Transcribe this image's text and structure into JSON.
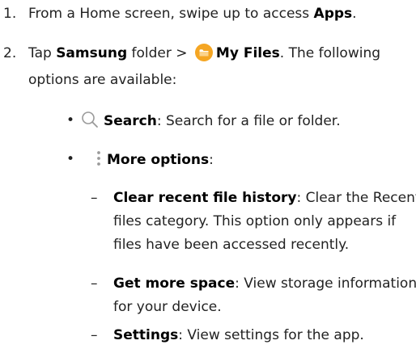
{
  "steps": [
    {
      "number": "1.",
      "text_a": "From a Home screen, swipe up to access ",
      "bold_a": "Apps",
      "text_b": "."
    },
    {
      "number": "2.",
      "text_a": "Tap ",
      "bold_a": "Samsung",
      "text_b": " folder > ",
      "bold_b": "My Files",
      "text_c": ". The following",
      "line2": "options are available:",
      "icon": "folder-icon"
    }
  ],
  "options": [
    {
      "icon": "search-icon",
      "label": "Search",
      "description": ": Search for a file or folder."
    },
    {
      "icon": "more-options-icon",
      "label": "More options",
      "description": ":"
    }
  ],
  "sub_options": [
    {
      "label": "Clear recent file history",
      "description_line1": ": Clear the Recent",
      "description_line2": "files category. This option only appears if",
      "description_line3": "files have been accessed recently."
    },
    {
      "label": "Get more space",
      "description_line1": ": View storage information",
      "description_line2": "for your device."
    },
    {
      "label": "Settings",
      "description_line1": ": View settings for the app."
    }
  ],
  "symbols": {
    "bullet": "•",
    "dash": "–"
  },
  "colors": {
    "folder_icon": "#f5a623",
    "text": "#222222",
    "icon_gray": "#9a9a9a"
  }
}
